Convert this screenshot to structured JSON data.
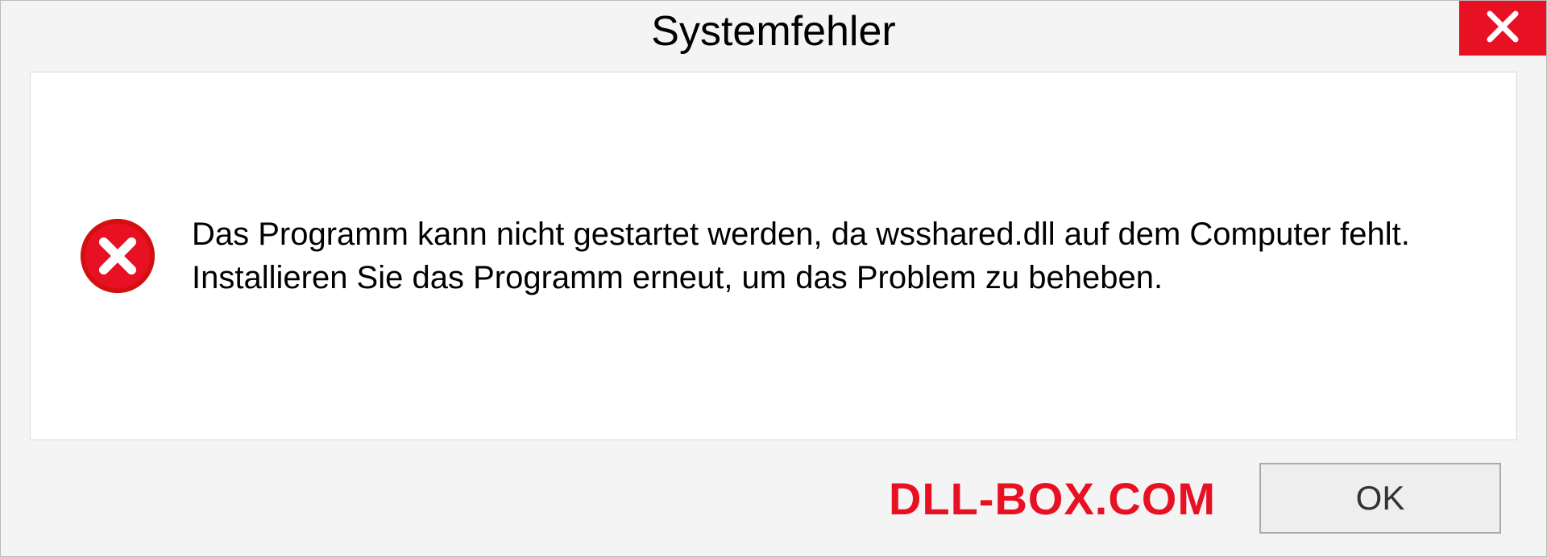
{
  "dialog": {
    "title": "Systemfehler",
    "message": "Das Programm kann nicht gestartet werden, da wsshared.dll auf dem Computer fehlt. Installieren Sie das Programm erneut, um das Problem zu beheben.",
    "ok_label": "OK"
  },
  "watermark": "DLL-BOX.COM",
  "colors": {
    "error_red": "#e81123",
    "close_red": "#e81123"
  }
}
